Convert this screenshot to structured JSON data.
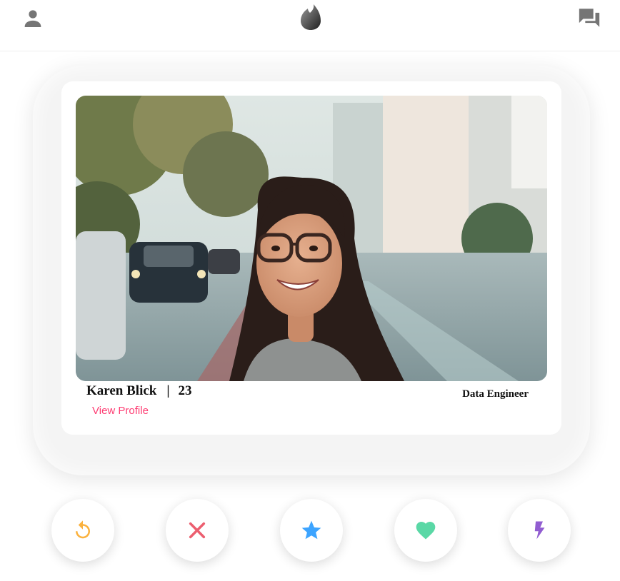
{
  "header": {
    "profile_icon": "person-icon",
    "logo_icon": "flame-logo-icon",
    "messages_icon": "chat-bubbles-icon"
  },
  "card": {
    "name": "Karen Blick",
    "separator": "|",
    "age": "23",
    "job": "Data Engineer",
    "view_profile_label": "View Profile",
    "photo_alt": "profile-photo"
  },
  "actions": [
    {
      "id": "rewind",
      "icon": "rewind-icon",
      "color": "#fbb23e"
    },
    {
      "id": "nope",
      "icon": "close-icon",
      "color": "#ec5e6f"
    },
    {
      "id": "super-like",
      "icon": "star-icon",
      "color": "#3ca4ff"
    },
    {
      "id": "like",
      "icon": "heart-icon",
      "color": "#5ad8a6"
    },
    {
      "id": "boost",
      "icon": "lightning-icon",
      "color": "#915dd1"
    }
  ],
  "colors": {
    "accent": "#fe3c72",
    "icon_gray": "#757575"
  }
}
